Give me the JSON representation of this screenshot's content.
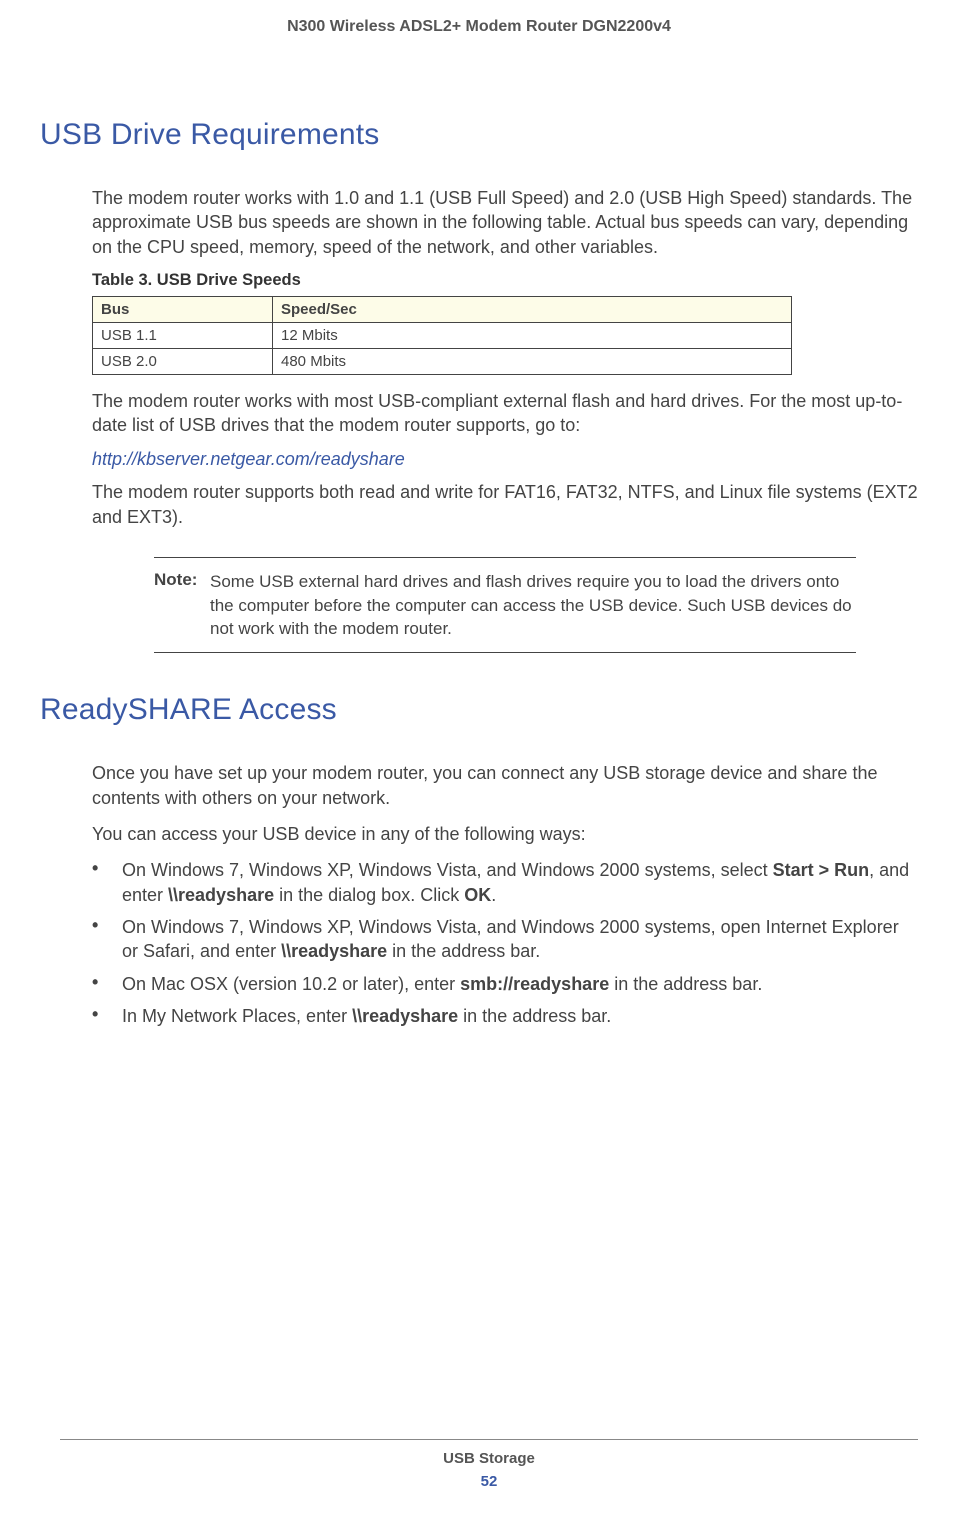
{
  "header": {
    "title": "N300 Wireless ADSL2+ Modem Router DGN2200v4"
  },
  "section1": {
    "heading": "USB Drive Requirements",
    "para1": "The modem router works with 1.0 and 1.1 (USB Full Speed) and 2.0 (USB High Speed) standards. The approximate USB bus speeds are shown in the following table. Actual bus speeds can vary, depending on the CPU speed, memory, speed of the network, and other variables.",
    "table_caption": "Table 3.  USB Drive Speeds",
    "table": {
      "headers": [
        "Bus",
        "Speed/Sec"
      ],
      "rows": [
        [
          "USB 1.1",
          "12 Mbits"
        ],
        [
          "USB 2.0",
          "480 Mbits"
        ]
      ]
    },
    "para2": "The modem router works with most USB-compliant external flash and hard drives. For the most up-to-date list of USB drives that the modem router supports, go to:",
    "link": "http://kbserver.netgear.com/readyshare",
    "para3": "The modem router supports both read and write for FAT16, FAT32, NTFS, and Linux file systems (EXT2 and EXT3).",
    "note_label": "Note:",
    "note_text": "Some USB external hard drives and flash drives require you to load the drivers onto the computer before the computer can access the USB device. Such USB devices do not work with the modem router."
  },
  "section2": {
    "heading": "ReadySHARE Access",
    "para1": "Once you have set up your modem router, you can connect any USB storage device and share the contents with others on your network.",
    "para2": "You can access your USB device in any of the following ways:",
    "bullets": [
      {
        "pre1": "On Windows 7, Windows XP, Windows Vista, and Windows 2000 systems, select ",
        "b1": "Start > Run",
        "mid1": ", and enter ",
        "b2": "\\\\readyshare",
        "mid2": " in the dialog box. Click ",
        "b3": "OK",
        "post": "."
      },
      {
        "pre1": "On Windows 7, Windows XP, Windows Vista, and Windows 2000 systems, open Internet Explorer or Safari, and enter ",
        "b1": "\\\\readyshare",
        "post": " in the address bar."
      },
      {
        "pre1": "On Mac OSX (version 10.2 or later), enter ",
        "b1": "smb://readyshare",
        "post": " in the address bar."
      },
      {
        "pre1": "In My Network Places, enter ",
        "b1": "\\\\readyshare",
        "post": " in the address bar."
      }
    ]
  },
  "footer": {
    "section": "USB Storage",
    "page": "52"
  }
}
